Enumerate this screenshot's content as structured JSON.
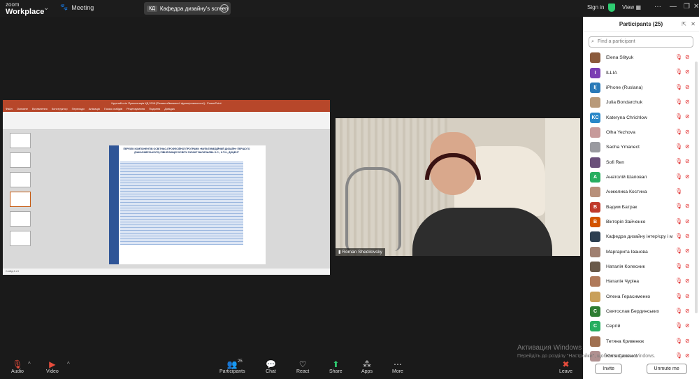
{
  "app": {
    "brand_line1": "zoom",
    "brand_line2": "Workplace"
  },
  "top": {
    "meeting_label": "Meeting",
    "share_tag": "КД",
    "share_label": "Кафедра дизайну's screen",
    "signin": "Sign in",
    "view": "View"
  },
  "presentation": {
    "window_title": "Круглий стіл Презентація КД 2016 [Режим обмеженої функціональності] - PowerPoint",
    "tabs": [
      "Файл",
      "Основне",
      "Вставлення",
      "Конструктор",
      "Переходи",
      "Анімація",
      "Показ слайдів",
      "Рецензування",
      "Подання",
      "Довідка"
    ],
    "slide_title": "ПЕРЕЛІК КОМПОНЕНТІВ ОСВІТНЬО-ПРОФЕСІЙНОЇ ПРОГРАМИ «МУЛЬТИМЕДІЙНИЙ ДИЗАЙН» ПЕРШОГО (БАКАЛАВРСЬКОГО) РІВНЯ ВИЩОЇ ОСВІТИ ГАРАНТ ВАСИЛЬЄВА О.С., К.Т.Н., ДОЦЕНТ",
    "status": "Слайд 4 з 6"
  },
  "video": {
    "participant_name": "Roman Shedilovsky"
  },
  "panel": {
    "title": "Participants (25)",
    "search_placeholder": "Find a participant",
    "invite": "Invite",
    "unmute_me": "Unmute me",
    "participants": [
      {
        "name": "Elena Slityuk",
        "initials": "",
        "color": "#8b5a3c"
      },
      {
        "name": "ILLIA",
        "initials": "I",
        "color": "#7b3fb3"
      },
      {
        "name": "iPhone (Ruslana)",
        "initials": "I(",
        "color": "#2a7ab8"
      },
      {
        "name": "Julia Bondarchuk",
        "initials": "",
        "color": "#b89a7a"
      },
      {
        "name": "Kateryna Chrichlow",
        "initials": "KC",
        "color": "#2a88c8"
      },
      {
        "name": "Olha Yezhova",
        "initials": "",
        "color": "#c79a9a"
      },
      {
        "name": "Sacha Ymanect",
        "initials": "",
        "color": "#9a9aa0"
      },
      {
        "name": "Sofi Ren",
        "initials": "",
        "color": "#6a4f7a"
      },
      {
        "name": "Анатолій Шаповал",
        "initials": "А",
        "color": "#27ae60"
      },
      {
        "name": "Анжелика Костина",
        "initials": "",
        "color": "#b8907a"
      },
      {
        "name": "Вадим Батрак",
        "initials": "В",
        "color": "#c0392b"
      },
      {
        "name": "Вікторія Зайченко",
        "initials": "В",
        "color": "#d35400"
      },
      {
        "name": "Кафедра дизайну інтер'єру і м...",
        "initials": "",
        "color": "#2c3e50"
      },
      {
        "name": "Маргарита Іванова",
        "initials": "",
        "color": "#a08070"
      },
      {
        "name": "Наталія Колесник",
        "initials": "",
        "color": "#6a5a4a"
      },
      {
        "name": "Наталія Чуріна",
        "initials": "",
        "color": "#b07a5a"
      },
      {
        "name": "Олена Герасименко",
        "initials": "",
        "color": "#c9a05a"
      },
      {
        "name": "Святослав Бердинських",
        "initials": "С",
        "color": "#2e7d32"
      },
      {
        "name": "Сергій",
        "initials": "С",
        "color": "#27ae60"
      },
      {
        "name": "Тетяна Кривенюк",
        "initials": "",
        "color": "#a07050"
      },
      {
        "name": "Юлія Силенко",
        "initials": "",
        "color": "#b09090"
      }
    ]
  },
  "activation": {
    "line1": "Активация Windows",
    "line2": "Перейдіть до розділу \"Настройки\", щоб активувати Windows."
  },
  "toolbar": {
    "audio": "Audio",
    "video": "Video",
    "participants": "Participants",
    "participants_count": "25",
    "chat": "Chat",
    "react": "React",
    "share": "Share",
    "apps": "Apps",
    "more": "More",
    "leave": "Leave"
  }
}
